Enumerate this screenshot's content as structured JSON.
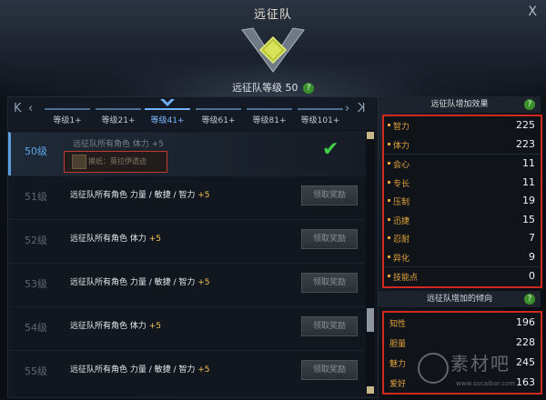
{
  "window": {
    "title": "远征队",
    "close_label": "X"
  },
  "header": {
    "level_text": "远征队等级 50",
    "help_label": "?"
  },
  "tabs": {
    "first_label": "K",
    "prev_label": "‹",
    "next_label": "›",
    "last_label": "K",
    "items": [
      {
        "label": "等级1+",
        "active": false
      },
      {
        "label": "等级21+",
        "active": false
      },
      {
        "label": "等级41+",
        "active": true
      },
      {
        "label": "等级61+",
        "active": false
      },
      {
        "label": "等级81+",
        "active": false
      },
      {
        "label": "等级101+",
        "active": false
      }
    ]
  },
  "rows": [
    {
      "level": "50级",
      "desc": "远征队所有角色 体力",
      "plus": "+5",
      "reward_text": "摸纸：莫拉伊遗迹",
      "status": "claimed"
    },
    {
      "level": "51级",
      "desc": "远征队所有角色 力量 / 敏捷 / 智力",
      "plus": "+5",
      "button": "领取奖励"
    },
    {
      "level": "52级",
      "desc": "远征队所有角色 体力",
      "plus": "+5",
      "button": "领取奖励"
    },
    {
      "level": "53级",
      "desc": "远征队所有角色 力量 / 敏捷 / 智力",
      "plus": "+5",
      "button": "领取奖励"
    },
    {
      "level": "54级",
      "desc": "远征队所有角色 体力",
      "plus": "+5",
      "button": "领取奖励"
    },
    {
      "level": "55级",
      "desc": "远征队所有角色 力量 / 敏捷 / 智力",
      "plus": "+5",
      "button": "领取奖励"
    }
  ],
  "effects": {
    "title": "远征队增加效果",
    "help_label": "?",
    "items": [
      {
        "name": "智力",
        "value": "225"
      },
      {
        "name": "体力",
        "value": "223"
      },
      {
        "name": "会心",
        "value": "11"
      },
      {
        "name": "专长",
        "value": "11"
      },
      {
        "name": "压制",
        "value": "19"
      },
      {
        "name": "迅捷",
        "value": "15"
      },
      {
        "name": "忍耐",
        "value": "7"
      },
      {
        "name": "异化",
        "value": "9"
      },
      {
        "name": "技能点",
        "value": "0"
      }
    ]
  },
  "tendency": {
    "title": "远征队增加的倾向",
    "help_label": "?",
    "items": [
      {
        "name": "知性",
        "value": "196"
      },
      {
        "name": "胆量",
        "value": "228"
      },
      {
        "name": "魅力",
        "value": "245"
      },
      {
        "name": "爱好",
        "value": "163"
      }
    ]
  },
  "watermark": {
    "text": "素材吧",
    "url": "www.sucaibar.com"
  },
  "colors": {
    "accent": "#6fb2ff",
    "highlight_border": "#d02a20",
    "stat_label": "#e3a33a",
    "bonus": "#f2c550",
    "check": "#3fce4a"
  }
}
